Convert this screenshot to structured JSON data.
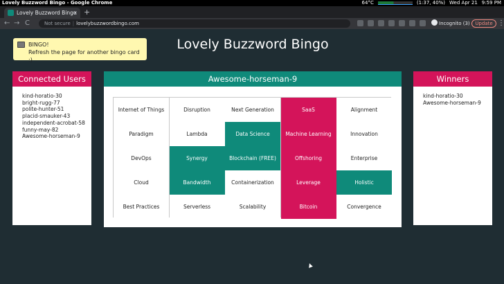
{
  "os_bar": {
    "window_title": "Lovely Buzzword Bingo - Google Chrome",
    "temperature": "64°C",
    "battery": "(1:37, 40%)",
    "datetime": "Wed Apr 21",
    "time": "9:59 PM"
  },
  "browser": {
    "tab_title": "Lovely Buzzword Bingo",
    "new_tab": "+",
    "tab_close": "×",
    "back": "←",
    "forward": "→",
    "reload": "C",
    "security": "Not secure",
    "url": "lovelybuzzwordbingo.com",
    "incognito": "Incognito (3)",
    "update_label": "Update",
    "menu": "⋮"
  },
  "page": {
    "title": "Lovely Buzzword Bingo",
    "toast": {
      "title": "BINGO!",
      "message": "Refresh the page for another bingo card :)"
    },
    "connected_users": {
      "header": "Connected Users",
      "users": [
        "kind-horatio-30",
        "bright-rugg-77",
        "polite-hunter-51",
        "placid-smauker-43",
        "independent-acrobat-58",
        "funny-may-82",
        "Awesome-horseman-9"
      ]
    },
    "board": {
      "player": "Awesome-horseman-9",
      "cells": [
        {
          "label": "Internet of Things",
          "state": "none"
        },
        {
          "label": "Disruption",
          "state": "none"
        },
        {
          "label": "Next Generation",
          "state": "none"
        },
        {
          "label": "SaaS",
          "state": "pink"
        },
        {
          "label": "Alignment",
          "state": "none"
        },
        {
          "label": "Paradigm",
          "state": "none"
        },
        {
          "label": "Lambda",
          "state": "none"
        },
        {
          "label": "Data Science",
          "state": "teal"
        },
        {
          "label": "Machine Learning",
          "state": "pink"
        },
        {
          "label": "Innovation",
          "state": "none"
        },
        {
          "label": "DevOps",
          "state": "none"
        },
        {
          "label": "Synergy",
          "state": "teal"
        },
        {
          "label": "Blockchain (FREE)",
          "state": "teal"
        },
        {
          "label": "Offshoring",
          "state": "pink"
        },
        {
          "label": "Enterprise",
          "state": "none"
        },
        {
          "label": "Cloud",
          "state": "none"
        },
        {
          "label": "Bandwidth",
          "state": "teal"
        },
        {
          "label": "Containerization",
          "state": "none"
        },
        {
          "label": "Leverage",
          "state": "pink"
        },
        {
          "label": "Holistic",
          "state": "teal"
        },
        {
          "label": "Best Practices",
          "state": "none"
        },
        {
          "label": "Serverless",
          "state": "none"
        },
        {
          "label": "Scalability",
          "state": "none"
        },
        {
          "label": "Bitcoin",
          "state": "pink"
        },
        {
          "label": "Convergence",
          "state": "none"
        }
      ]
    },
    "winners": {
      "header": "Winners",
      "names": [
        "kind-horatio-30",
        "Awesome-horseman-9"
      ]
    }
  },
  "colors": {
    "background": "#1f2d33",
    "pink": "#d4145a",
    "teal": "#0f8a7a",
    "toast": "#fff8b0"
  }
}
